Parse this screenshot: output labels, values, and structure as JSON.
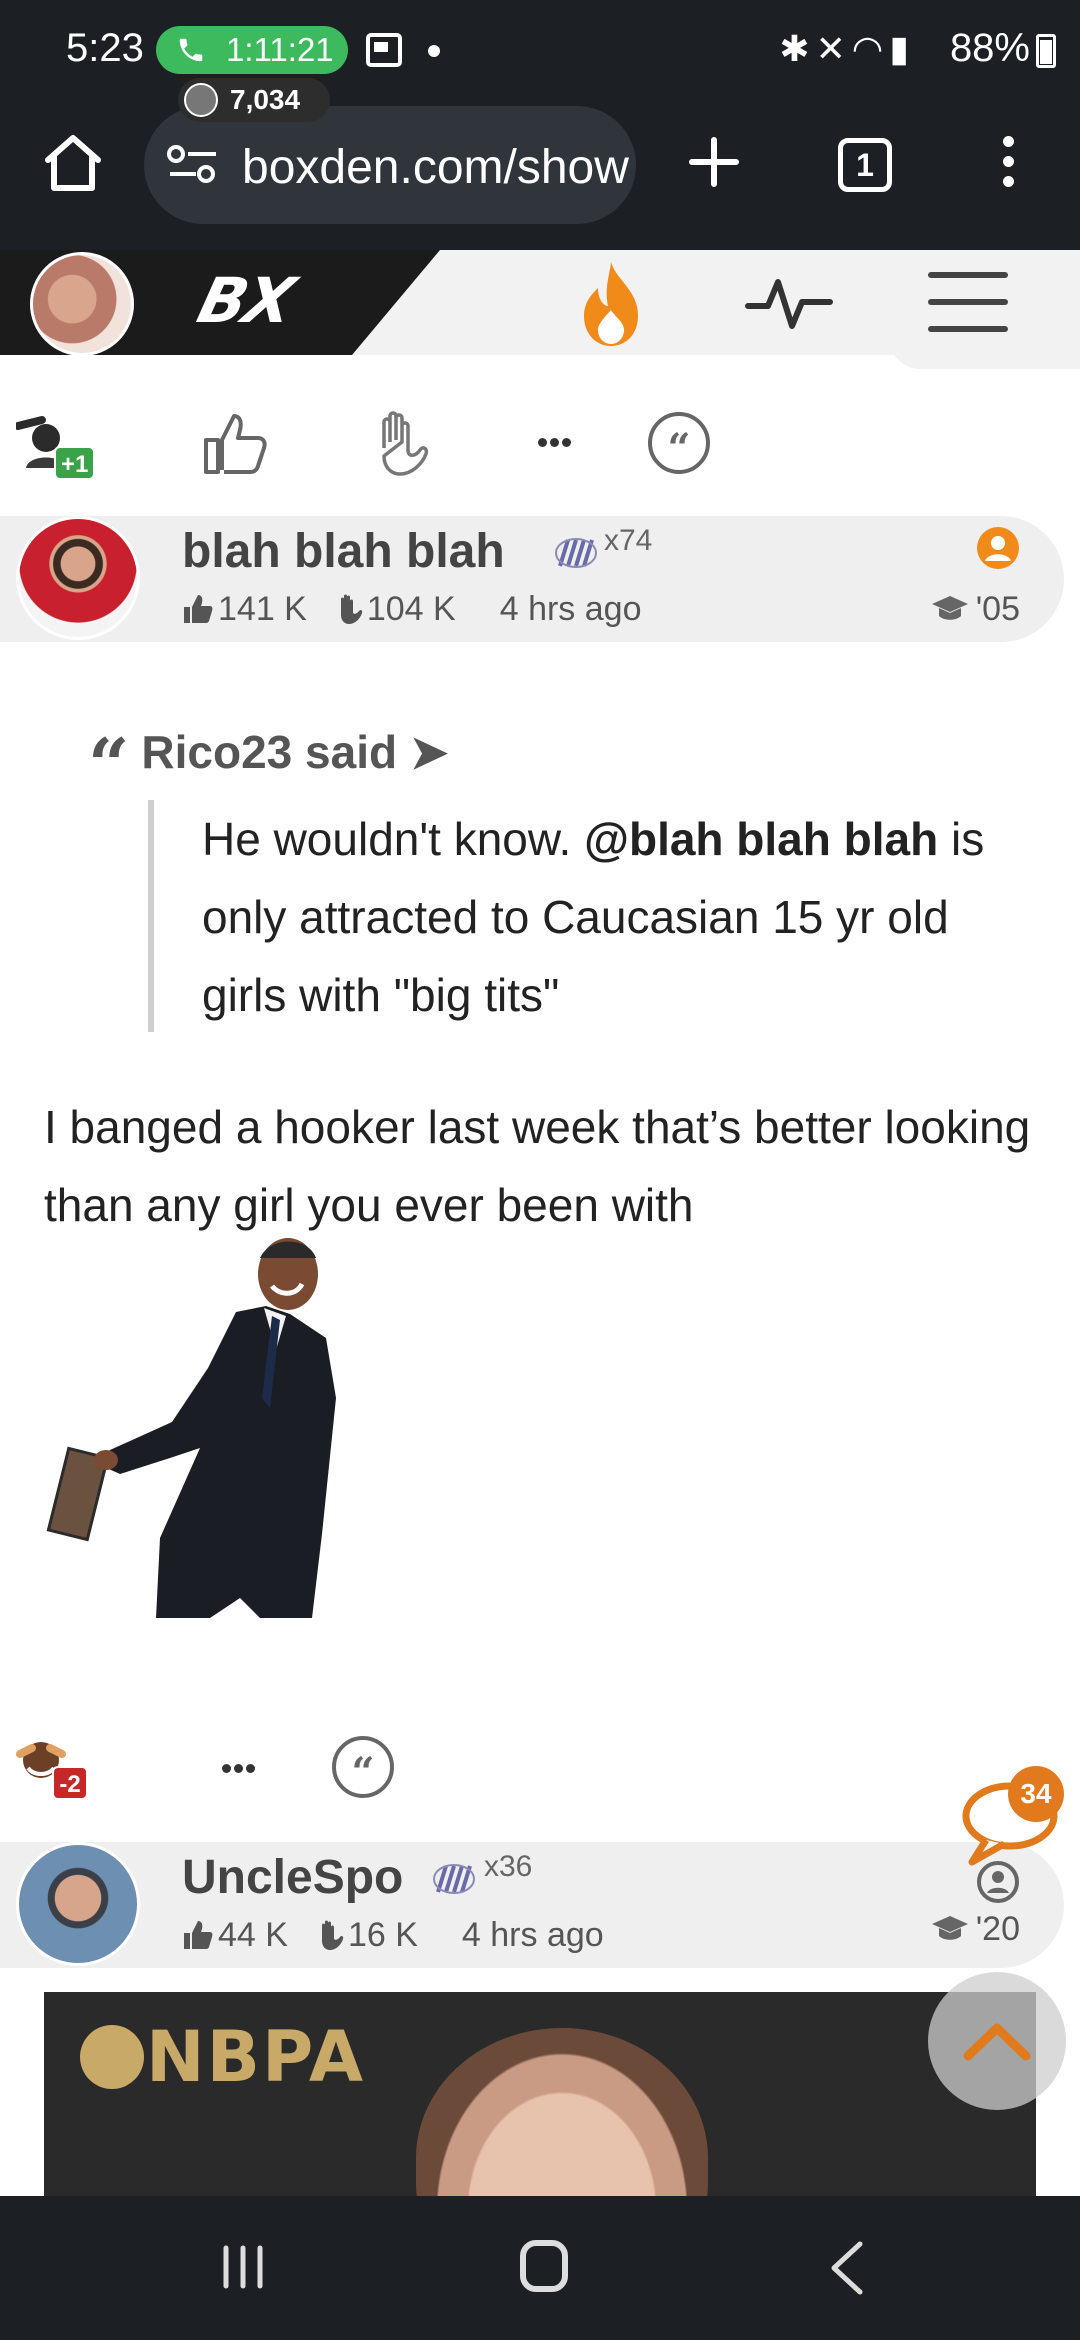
{
  "status_bar": {
    "time": "5:23",
    "call_timer": "1:11:21",
    "battery": "88%"
  },
  "browser": {
    "url": "boxden.com/show",
    "tab_count": "1"
  },
  "site_header": {
    "logo": "BX",
    "online_count": "7,034"
  },
  "post1_actions": {
    "score": "+1",
    "score_color": "#3aa34a"
  },
  "post1": {
    "username": "blah blah blah",
    "rank_multiplier": "x74",
    "likes": "141 K",
    "dislikes": "104 K",
    "time_ago": "4 hrs ago",
    "join_year": "'05",
    "quote_author": "Rico23 said ➤",
    "quote_text_1": "He wouldn't know. ",
    "quote_mention": "@blah blah blah",
    "quote_text_2": " is only attracted to Caucasian 15 yr old girls with \"big tits\"",
    "body": "I banged a hooker last week that’s better looking than any girl you ever been with"
  },
  "post2_actions": {
    "score": "-2",
    "score_color": "#c62828"
  },
  "floating": {
    "chat_count": "34",
    "accent": "#e07a1d"
  },
  "post2": {
    "username": "UncleSpo",
    "rank_multiplier": "x36",
    "likes": "44 K",
    "dislikes": "16 K",
    "time_ago": "4 hrs ago",
    "join_year": "'20",
    "embed_logo": "NBPA"
  }
}
